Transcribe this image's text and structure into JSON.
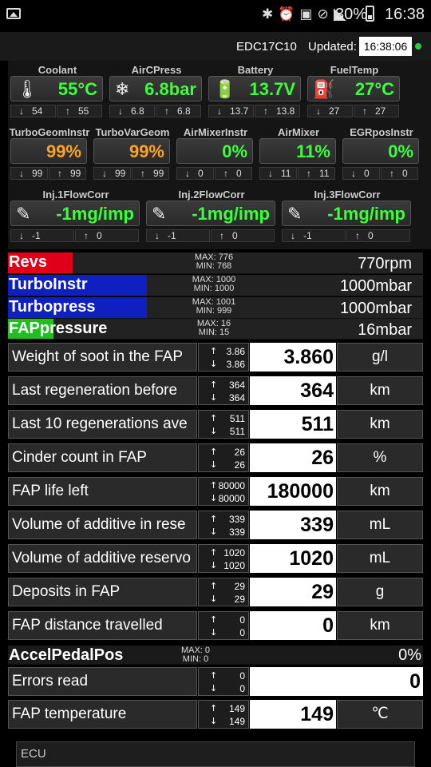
{
  "status_bar": {
    "battery": "30%",
    "time": "16:38"
  },
  "header": {
    "ecu": "EDC17C10",
    "updated_label": "Updated:",
    "updated_time": "16:38:06"
  },
  "gauges1": [
    {
      "label": "Coolant",
      "value": "55°C",
      "min": "54",
      "max": "55",
      "icon": "thermometer-icon"
    },
    {
      "label": "AirCPress",
      "value": "6.8bar",
      "min": "6.8",
      "max": "6.8",
      "icon": "snowflake-icon"
    },
    {
      "label": "Battery",
      "value": "13.7V",
      "min": "13.7",
      "max": "13.8",
      "icon": "battery-icon"
    },
    {
      "label": "FuelTemp",
      "value": "27°C",
      "min": "27",
      "max": "27",
      "icon": "fuel-pump-icon"
    }
  ],
  "gauges2": [
    {
      "label": "TurboGeomInstr",
      "value": "99%",
      "min": "99",
      "max": "99"
    },
    {
      "label": "TurboVarGeom",
      "value": "99%",
      "min": "99",
      "max": "99"
    },
    {
      "label": "AirMixerInstr",
      "value": "0%",
      "min": "0",
      "max": "0"
    },
    {
      "label": "AirMixer",
      "value": "11%",
      "min": "11",
      "max": "11"
    },
    {
      "label": "EGRposInstr",
      "value": "0%",
      "min": "0",
      "max": "0"
    }
  ],
  "gauges3": [
    {
      "label": "Inj.1FlowCorr",
      "value": "-1mg/imp",
      "min": "-1",
      "max": "0"
    },
    {
      "label": "Inj.2FlowCorr",
      "value": "-1mg/imp",
      "min": "-1",
      "max": "0"
    },
    {
      "label": "Inj.3FlowCorr",
      "value": "-1mg/imp",
      "min": "-1",
      "max": "0"
    }
  ],
  "bars": [
    {
      "name": "Revs",
      "max": "MAX: 776",
      "min": "MIN: 768",
      "value": "770rpm",
      "color": "#e0001a",
      "fill": 0.155
    },
    {
      "name": "TurboInstr",
      "max": "MAX: 1000",
      "min": "MIN: 1000",
      "value": "1000mbar",
      "color": "#1020c0",
      "fill": 0.335
    },
    {
      "name": "Turbopress",
      "max": "MAX: 1001",
      "min": "MIN: 999",
      "value": "1000mbar",
      "color": "#1020c0",
      "fill": 0.335
    },
    {
      "name": "FAPpressure",
      "max": "MAX: 16",
      "min": "MIN: 15",
      "value": "16mbar",
      "color": "#1fbf1f",
      "fill": 0.11
    }
  ],
  "rows": [
    {
      "name": "Weight of soot in the FAP",
      "max": "3.86",
      "min": "3.86",
      "value": "3.860",
      "unit": "g/l"
    },
    {
      "name": "Last regeneration before",
      "max": "364",
      "min": "364",
      "value": "364",
      "unit": "km"
    },
    {
      "name": "Last 10 regenerations ave",
      "max": "511",
      "min": "511",
      "value": "511",
      "unit": "km"
    },
    {
      "name": "Cinder count in FAP",
      "max": "26",
      "min": "26",
      "value": "26",
      "unit": "%"
    },
    {
      "name": "FAP life left",
      "max": "80000",
      "min": "80000",
      "value": "180000",
      "unit": "km"
    },
    {
      "name": "Volume of additive in rese",
      "max": "339",
      "min": "339",
      "value": "339",
      "unit": "mL"
    },
    {
      "name": "Volume of additive reservo",
      "max": "1020",
      "min": "1020",
      "value": "1020",
      "unit": "mL"
    },
    {
      "name": "Deposits in FAP",
      "max": "29",
      "min": "29",
      "value": "29",
      "unit": "g"
    },
    {
      "name": "FAP distance travelled",
      "max": "0",
      "min": "0",
      "value": "0",
      "unit": "km"
    }
  ],
  "accel": {
    "name": "AccelPedalPos",
    "max": "MAX: 0",
    "min": "MIN: 0",
    "value": "0%"
  },
  "errors": {
    "name": "Errors read",
    "max": "0",
    "min": "0",
    "value": "0"
  },
  "faptemp": {
    "name": "FAP temperature",
    "max": "149",
    "min": "149",
    "value": "149",
    "unit": "℃"
  },
  "footer": {
    "label": "ECU"
  }
}
